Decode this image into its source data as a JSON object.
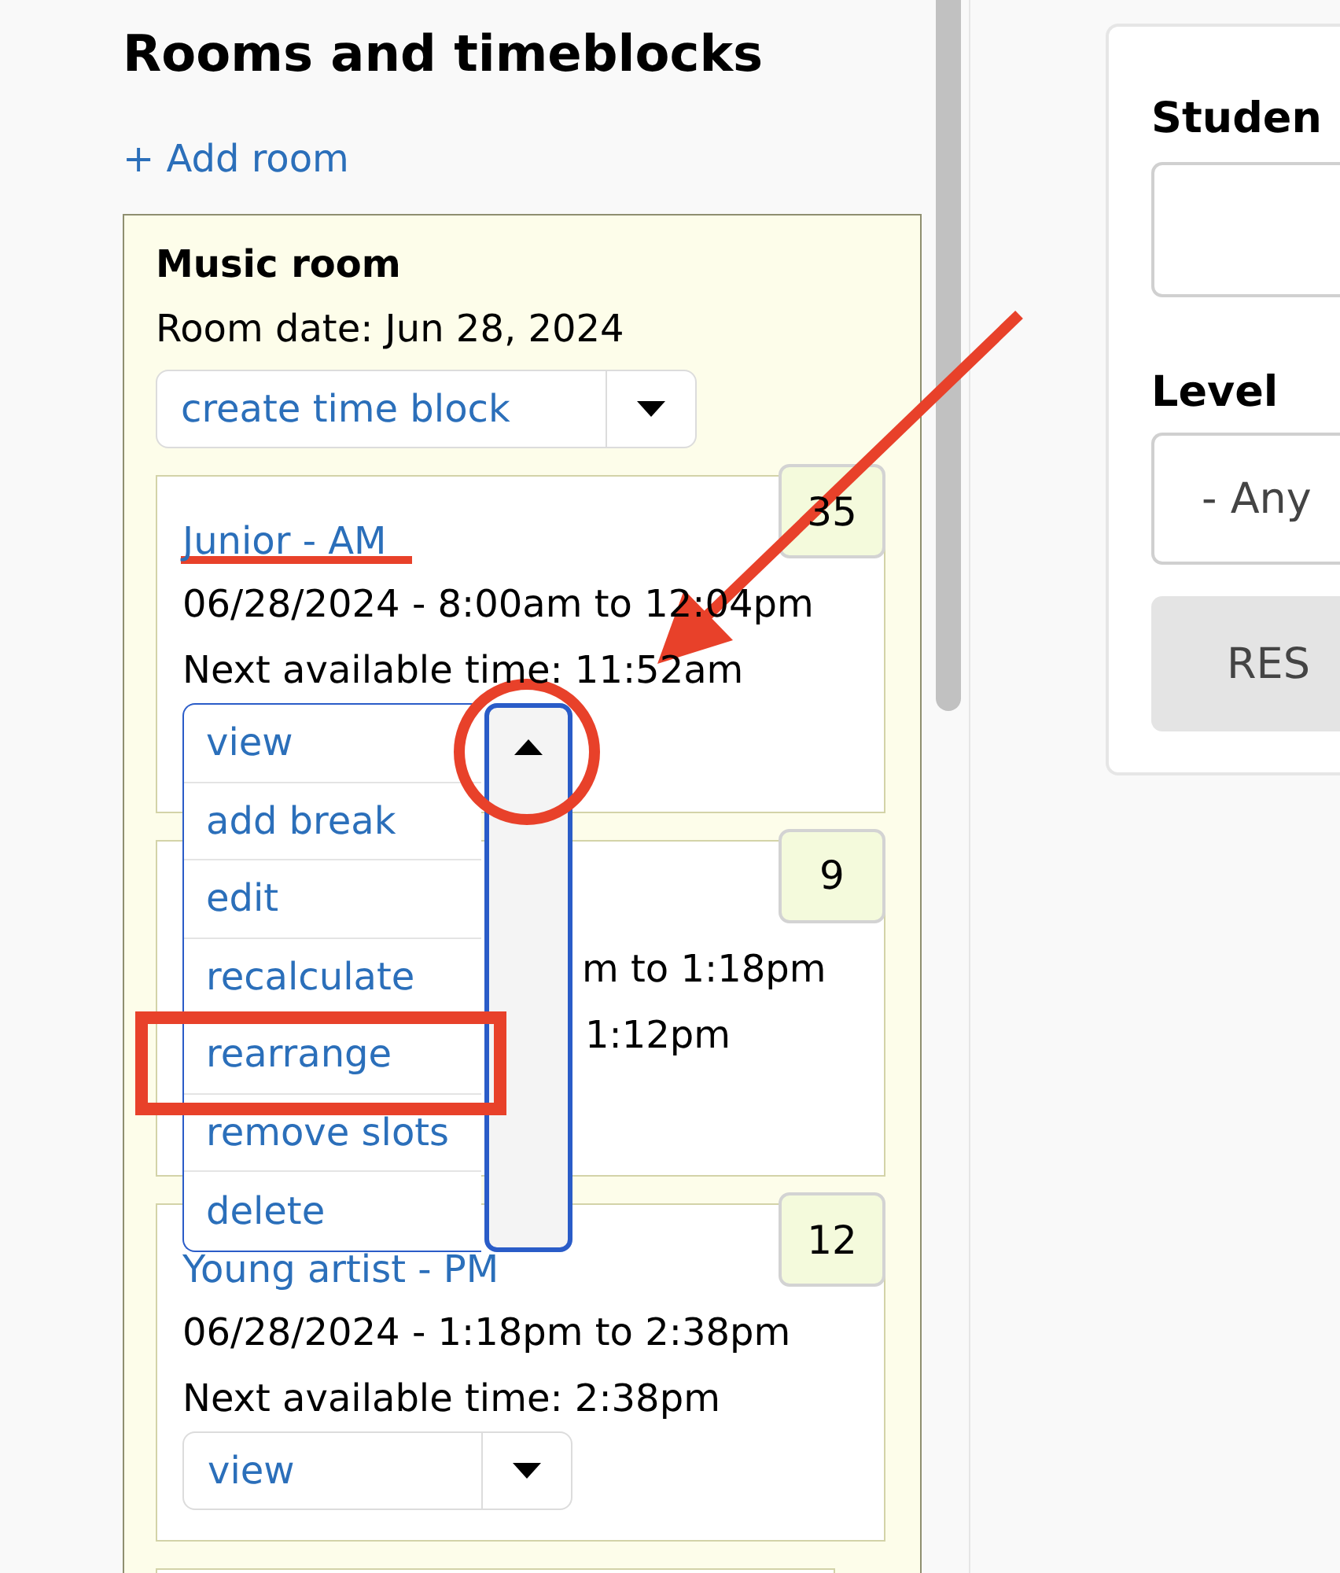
{
  "heading": "Rooms and timeblocks",
  "add_room_link": "+ Add room",
  "room": {
    "name": "Music room",
    "date": "Room date: Jun 28, 2024",
    "action": {
      "label": "create time block",
      "open": false
    },
    "time_blocks": [
      {
        "kind": "full",
        "title": "Junior - AM",
        "count": "35",
        "schedule": "06/28/2024 - 8:00am to 12:04pm",
        "next": "Next available time: 11:52am",
        "action": {
          "label": "view",
          "open": true
        },
        "menu": [
          "add break",
          "edit",
          "recalculate",
          "rearrange",
          "remove slots",
          "delete"
        ]
      },
      {
        "kind": "covered",
        "count": "9",
        "schedule": "m to 1:18pm",
        "next": "1:12pm"
      },
      {
        "kind": "full",
        "title": "Young artist - PM",
        "count": "12",
        "schedule": "06/28/2024 - 1:18pm to 2:38pm",
        "next": "Next available time: 2:38pm",
        "action": {
          "label": "view",
          "open": false
        }
      },
      {
        "kind": "edge"
      }
    ]
  },
  "filters": {
    "student_label": "Studen",
    "level_label": "Level",
    "level_value": "- Any",
    "button": "RES"
  }
}
